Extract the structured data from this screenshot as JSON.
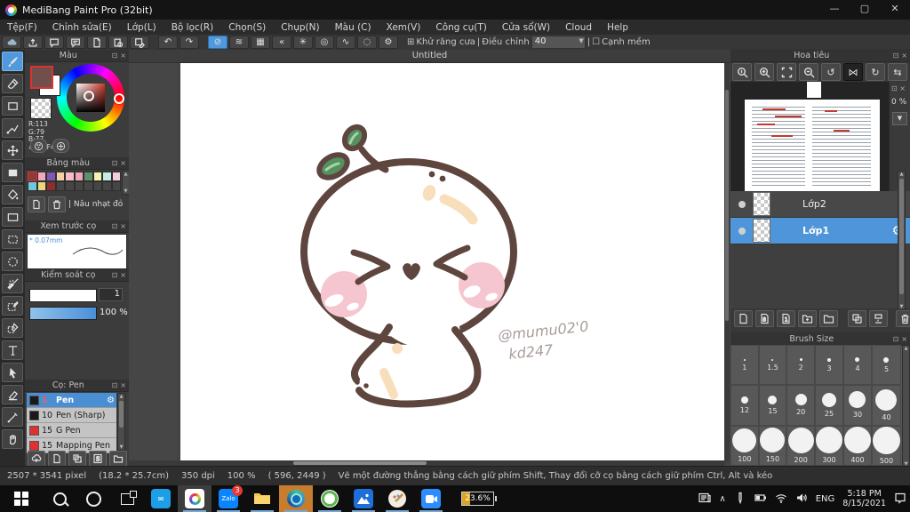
{
  "window": {
    "title": "MediBang Paint Pro (32bit)"
  },
  "menu": {
    "items": [
      "Tệp(F)",
      "Chỉnh sửa(E)",
      "Lớp(L)",
      "Bộ lọc(R)",
      "Chọn(S)",
      "Chụp(N)",
      "Màu (C)",
      "Xem(V)",
      "Công cụ(T)",
      "Cửa sổ(W)",
      "Cloud",
      "Help"
    ]
  },
  "toolbar": {
    "antialias_label": "Khử răng cưa",
    "correction_label": "Điều chỉnh",
    "correction_value": "40",
    "soft_edge_label": "Cạnh mềm"
  },
  "color_panel": {
    "title": "Màu",
    "r": "R:113",
    "g": "G:79",
    "b": "B:77",
    "hex": "#714F4D",
    "fg_color": "#714F4D"
  },
  "palette_panel": {
    "title": "Bảng màu",
    "selected_name": "| Nâu nhạt đỏ",
    "colors": [
      "#8a3c3c",
      "#f2a8bc",
      "#7a5ab0",
      "#f6cfa4",
      "#f6bcca",
      "#f2a4b8",
      "#5d8f6d",
      "#f6f2ac",
      "#c2ece4",
      "#f6ccd6",
      "#6cc8da",
      "#ead880",
      "#8c2e2e"
    ]
  },
  "preview_panel": {
    "title": "Xem trước cọ",
    "size_label": "* 0.07mm"
  },
  "control_panel": {
    "title": "Kiểm soát cọ",
    "size_value": "1",
    "opacity_value": "100 %"
  },
  "brush_panel": {
    "title": "Cọ: Pen",
    "brushes": [
      {
        "size": "1",
        "name": "Pen",
        "color": "#1a1a1a"
      },
      {
        "size": "10",
        "name": "Pen (Sharp)",
        "color": "#1a1a1a"
      },
      {
        "size": "15",
        "name": "G Pen",
        "color": "#e03030"
      },
      {
        "size": "15",
        "name": "Mapping Pen",
        "color": "#e03030"
      }
    ]
  },
  "canvas": {
    "tab": "Untitled",
    "signature_line1": "@mumu02'0",
    "signature_line2": "kd247"
  },
  "navigator": {
    "title": "Hoa tiêu"
  },
  "layers_panel": {
    "opacity": "0 %",
    "layers": [
      {
        "name": "Lớp2"
      },
      {
        "name": "Lớp1"
      }
    ]
  },
  "brush_size_panel": {
    "title": "Brush Size",
    "sizes": [
      "1",
      "1.5",
      "2",
      "3",
      "4",
      "5",
      "12",
      "15",
      "20",
      "25",
      "30",
      "40",
      "100",
      "150",
      "200",
      "300",
      "400",
      "500"
    ]
  },
  "status": {
    "dimensions": "2507 * 3541 pixel",
    "size_cm": "(18.2 * 25.7cm)",
    "dpi": "350 dpi",
    "zoom": "100 %",
    "coords": "( 596, 2449 )",
    "hint": "Vẽ một đường thẳng bằng cách giữ phím Shift, Thay đổi cỡ cọ bằng cách giữ phím Ctrl, Alt và kéo"
  },
  "taskbar": {
    "zalo_badge": "3",
    "battery_widget": "23.6%",
    "language": "ENG",
    "time": "5:18 PM",
    "date": "8/15/2021"
  },
  "colors": {
    "accent": "#4e96d9",
    "canvas_outline": "#5e463f",
    "blush": "#f5c6cf",
    "peach": "#f8debb",
    "leaf": "#55915f"
  }
}
